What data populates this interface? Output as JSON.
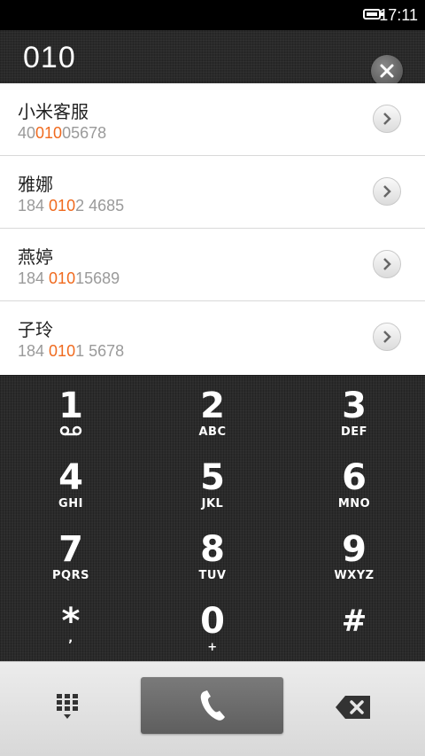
{
  "status_bar": {
    "time": "17:11"
  },
  "dial_entry": {
    "number": "010"
  },
  "results": [
    {
      "name": "小米客服",
      "phone_pre": "40",
      "phone_match": "010",
      "phone_post": "05678"
    },
    {
      "name": "雅娜",
      "phone_pre": "184 ",
      "phone_match": "010",
      "phone_post": "2 4685"
    },
    {
      "name": "燕婷",
      "phone_pre": "184 ",
      "phone_match": "010",
      "phone_post": "15689"
    },
    {
      "name": "子玲",
      "phone_pre": "184 ",
      "phone_match": "010",
      "phone_post": "1 5678"
    }
  ],
  "keypad": {
    "k1": {
      "digit": "1",
      "letters": ""
    },
    "k2": {
      "digit": "2",
      "letters": "ABC"
    },
    "k3": {
      "digit": "3",
      "letters": "DEF"
    },
    "k4": {
      "digit": "4",
      "letters": "GHI"
    },
    "k5": {
      "digit": "5",
      "letters": "JKL"
    },
    "k6": {
      "digit": "6",
      "letters": "MNO"
    },
    "k7": {
      "digit": "7",
      "letters": "PQRS"
    },
    "k8": {
      "digit": "8",
      "letters": "TUV"
    },
    "k9": {
      "digit": "9",
      "letters": "WXYZ"
    },
    "kstar": {
      "digit": "*",
      "letters": ","
    },
    "k0": {
      "digit": "0",
      "letters": "+"
    },
    "khash": {
      "digit": "#",
      "letters": ""
    }
  },
  "colors": {
    "match_highlight": "#f06a1e",
    "call_button": "#6b6b6b"
  },
  "icons": {
    "battery": "battery-icon",
    "clear": "close-icon",
    "detail": "chevron-right-icon",
    "voicemail": "voicemail-icon",
    "dialpad": "dialpad-icon",
    "call": "phone-icon",
    "backspace": "backspace-icon"
  }
}
